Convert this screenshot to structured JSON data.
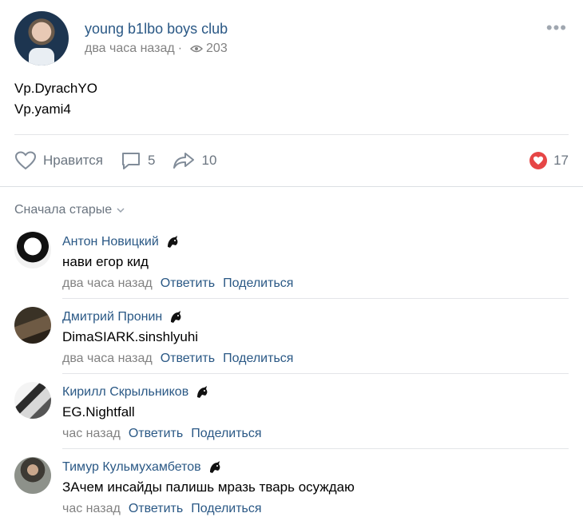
{
  "post": {
    "group_name": "young b1lbo boys club",
    "time": "два часа назад",
    "separator": "·",
    "views": "203",
    "lines": [
      "Vp.DyrachYO",
      "Vp.yami4"
    ]
  },
  "actions": {
    "like_label": "Нравится",
    "comments_count": "5",
    "shares_count": "10",
    "reactions_count": "17"
  },
  "sort_label": "Сначала старые",
  "comments": [
    {
      "author": "Антон Новицкий",
      "text": "нави егор кид",
      "time": "два часа назад",
      "reply": "Ответить",
      "share": "Поделиться"
    },
    {
      "author": "Дмитрий Пронин",
      "text": "DimaSIARK.sinshlyuhi",
      "time": "два часа назад",
      "reply": "Ответить",
      "share": "Поделиться"
    },
    {
      "author": "Кирилл Скрыльников",
      "text": "EG.Nightfall",
      "time": "час назад",
      "reply": "Ответить",
      "share": "Поделиться"
    },
    {
      "author": "Тимур Кульмухамбетов",
      "text": "ЗАчем инсайды палишь мразь тварь осуждаю",
      "time": "час назад",
      "reply": "Ответить",
      "share": "Поделиться"
    }
  ],
  "colors": {
    "link": "#2a5885",
    "meta": "#828282",
    "reaction": "#e64646"
  }
}
